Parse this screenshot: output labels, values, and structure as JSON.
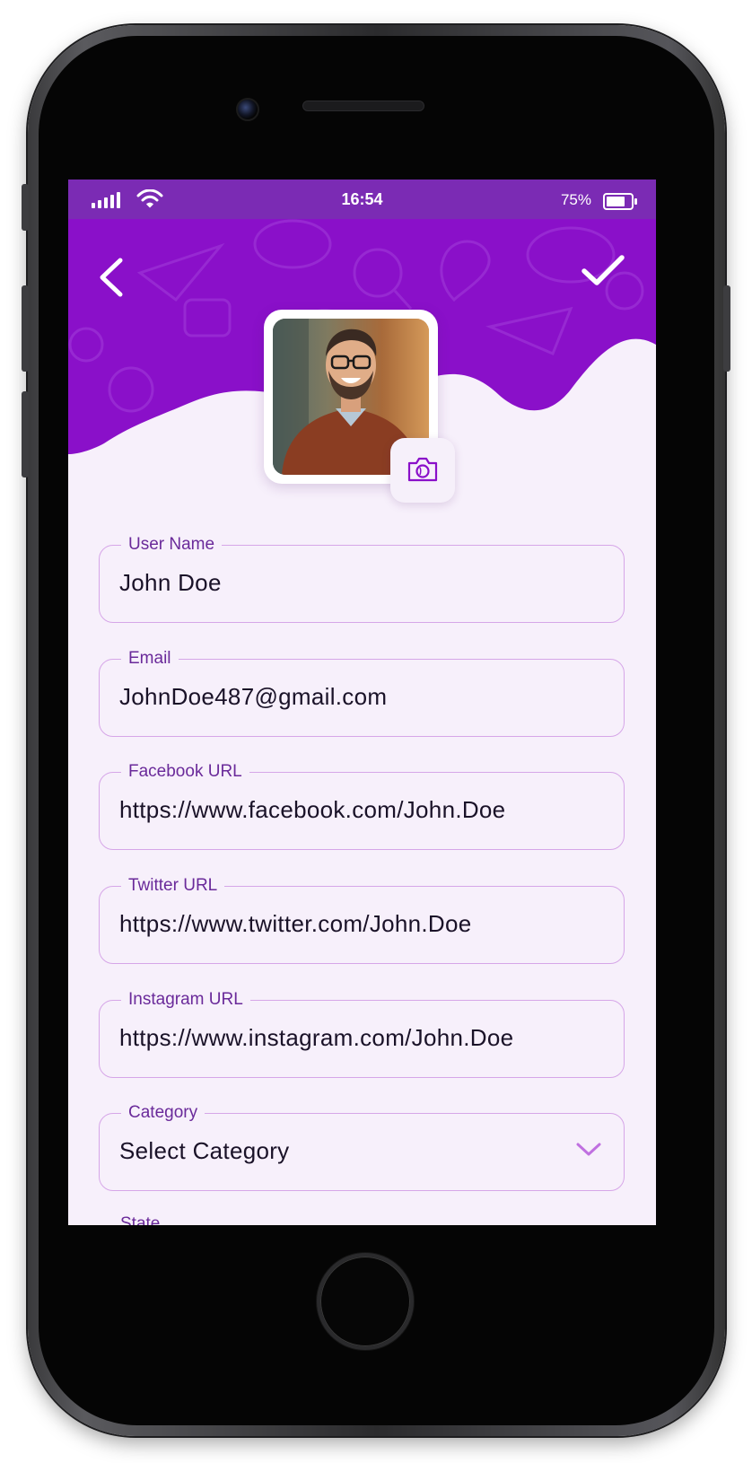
{
  "status_bar": {
    "time": "16:54",
    "battery_percent": "75%",
    "battery_level": 0.75
  },
  "header": {
    "back_icon": "chevron-left-icon",
    "save_icon": "checkmark-icon",
    "camera_icon": "camera-icon"
  },
  "form": {
    "fields": [
      {
        "label": "User Name",
        "value": "John Doe"
      },
      {
        "label": "Email",
        "value": "JohnDoe487@gmail.com"
      },
      {
        "label": "Facebook URL",
        "value": "https://www.facebook.com/John.Doe"
      },
      {
        "label": "Twitter URL",
        "value": "https://www.twitter.com/John.Doe"
      },
      {
        "label": "Instagram URL",
        "value": "https://www.instagram.com/John.Doe"
      }
    ],
    "category": {
      "label": "Category",
      "value": "Select Category"
    },
    "next_label": "State"
  },
  "colors": {
    "accent": "#8a10c9",
    "status_bar": "#7b2bb4",
    "field_border": "#d6a6e8",
    "label": "#6a2a9a",
    "background": "#f7f0fb"
  }
}
